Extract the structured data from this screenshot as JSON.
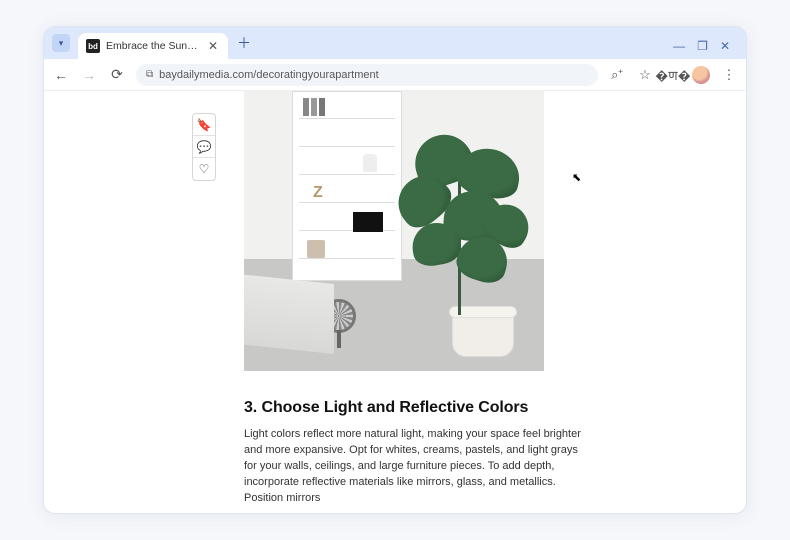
{
  "browser": {
    "tab": {
      "favicon_text": "bd",
      "title": "Embrace the Sunshine: Dec…"
    },
    "address": "baydailymedia.com/decoratingyourapartment"
  },
  "rail": {
    "bookmark_glyph": "🔖",
    "comment_glyph": "💬",
    "like_glyph": "♡"
  },
  "article": {
    "heading": "3. Choose Light and Reflective Colors",
    "body": "Light colors reflect more natural light, making your space feel brighter and more expansive. Opt for whites, creams, pastels, and light grays for your walls, ceilings, and large furniture pieces. To add depth, incorporate reflective materials like mirrors, glass, and metallics. Position mirrors"
  }
}
